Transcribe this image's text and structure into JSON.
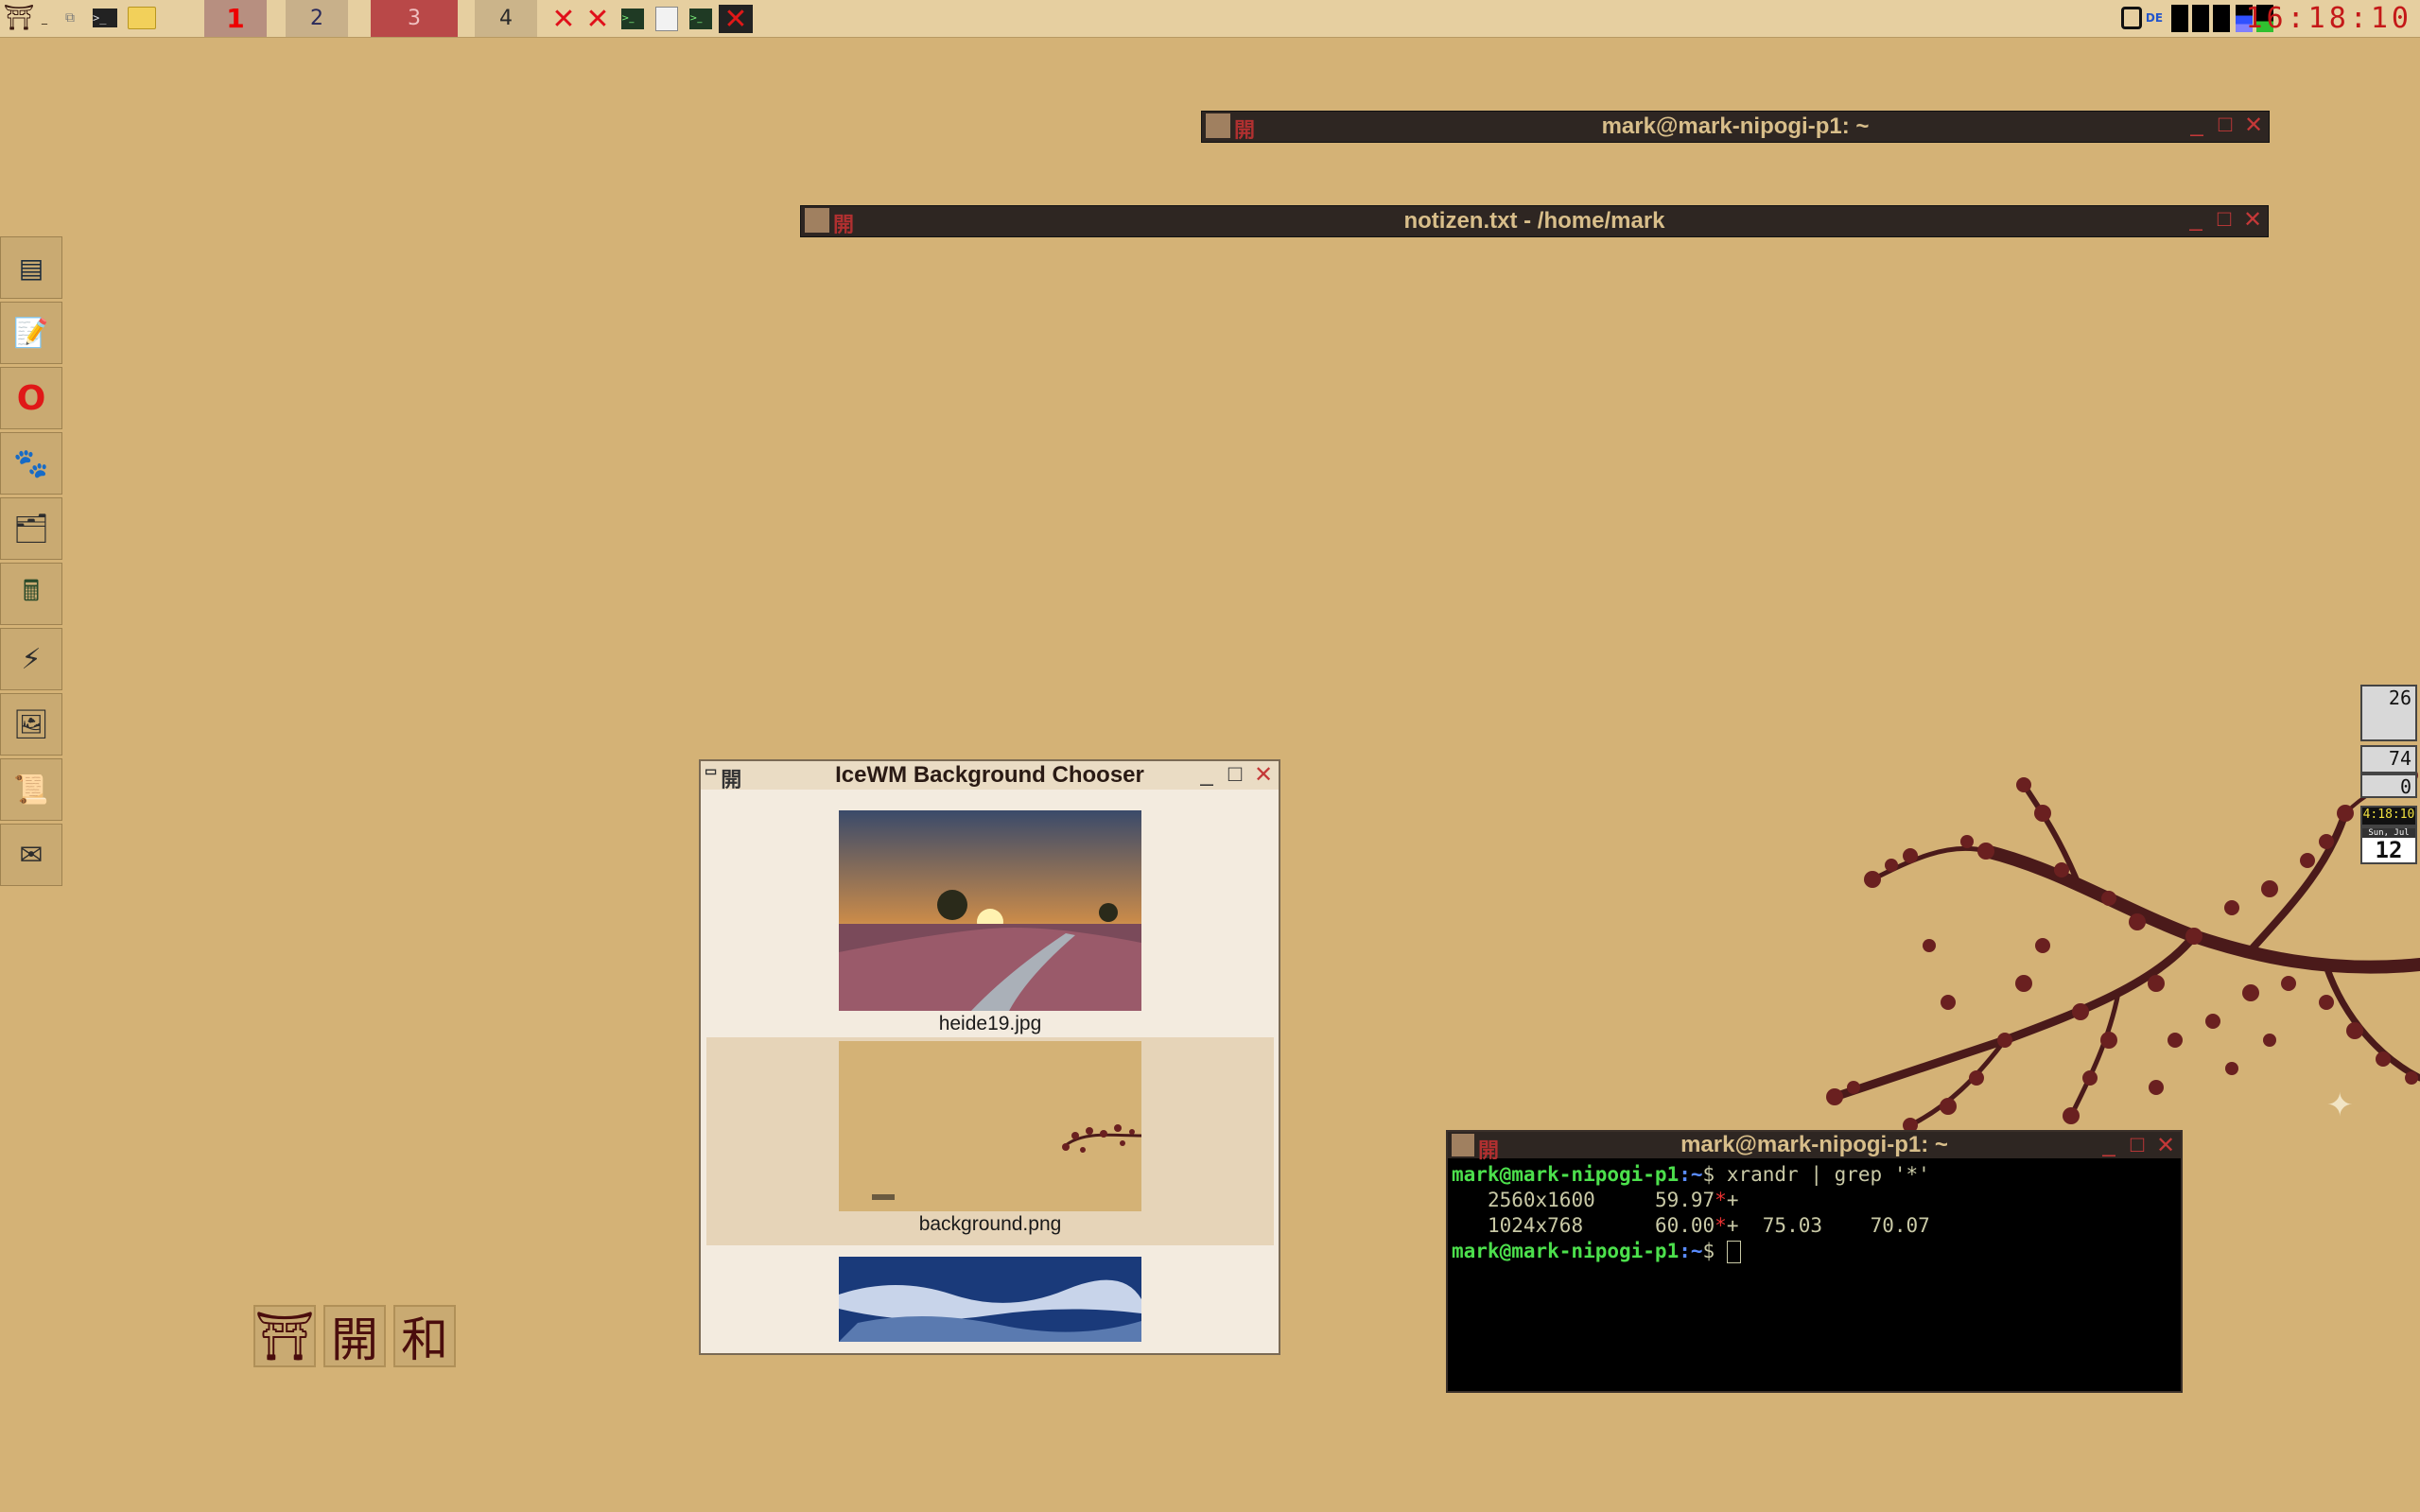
{
  "taskbar": {
    "start_icon": "torii-gate-icon",
    "workspaces": [
      "1",
      "2",
      "3",
      "4"
    ],
    "active_workspace": "3",
    "clock": "16:18:10",
    "keyboard_layout": "DE"
  },
  "dock": {
    "items": [
      {
        "name": "terminal-icon",
        "glyph": "▤"
      },
      {
        "name": "text-editor-icon",
        "glyph": "📝"
      },
      {
        "name": "opera-browser-icon",
        "glyph": "O"
      },
      {
        "name": "gimp-icon",
        "glyph": "🐾"
      },
      {
        "name": "file-manager-icon",
        "glyph": "🗂"
      },
      {
        "name": "calculator-icon",
        "glyph": "🖩"
      },
      {
        "name": "lightning-icon",
        "glyph": "⚡"
      },
      {
        "name": "image-viewer-icon",
        "glyph": "🖼"
      },
      {
        "name": "scroll-icon",
        "glyph": "📜"
      },
      {
        "name": "mail-icon",
        "glyph": "✉"
      }
    ]
  },
  "windows": {
    "terminal_top": {
      "title": "mark@mark-nipogi-p1: ~"
    },
    "notes": {
      "title": "notizen.txt - /home/mark"
    },
    "chooser": {
      "title": "IceWM Background Chooser",
      "items": [
        "heide19.jpg",
        "background.png",
        ""
      ]
    },
    "terminal_main": {
      "title": "mark@mark-nipogi-p1: ~",
      "prompt_user": "mark@mark-nipogi-p1",
      "prompt_path": ":~",
      "prompt_sign": "$",
      "command": "xrandr | grep '*'",
      "lines": [
        {
          "res": "2560x1600",
          "rate": "59.97",
          "mark": "*",
          "plus": "+",
          "extra": ""
        },
        {
          "res": "1024x768",
          "rate": "60.00",
          "mark": "*",
          "plus": "+",
          "extra": "75.03    70.07"
        }
      ]
    }
  },
  "kanji_buttons": [
    "⛩",
    "開",
    "和"
  ],
  "widgets": {
    "temp": "26",
    "cpu": "74",
    "load": "0",
    "time": "4:18:10",
    "weekday": "Sun, Jul",
    "day": "12"
  },
  "colors": {
    "desktop": "#d4b276",
    "title_dark": "#2e2622",
    "title_text": "#d8be8a",
    "prompt_green": "#4ce04c",
    "prompt_blue": "#5a8cff",
    "clock_red": "#c41818"
  }
}
